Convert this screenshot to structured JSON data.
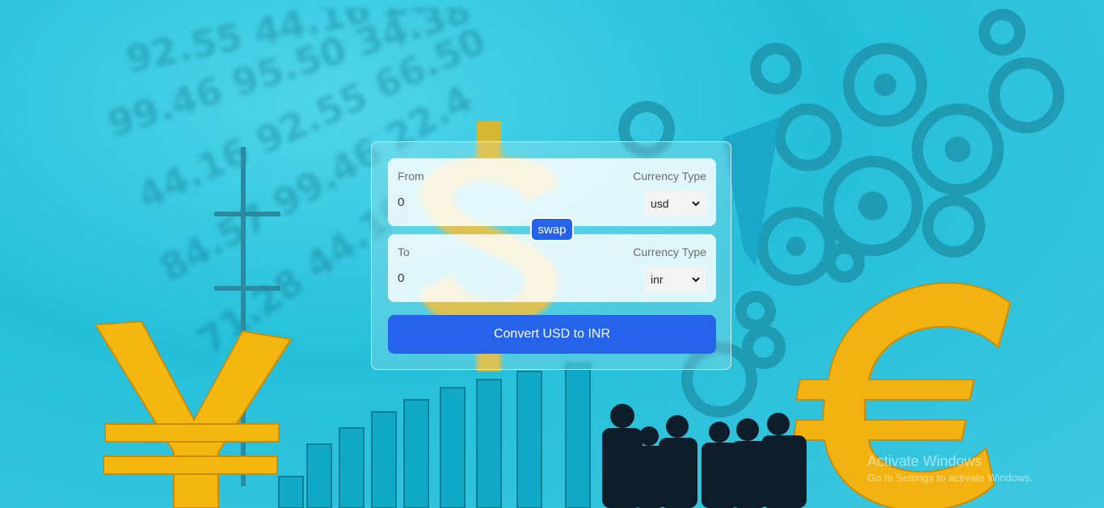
{
  "converter": {
    "from_label": "From",
    "from_currency_label": "Currency Type",
    "from_value": "0",
    "from_currency": "usd",
    "to_label": "To",
    "to_currency_label": "Currency Type",
    "to_value": "0",
    "to_currency": "inr",
    "swap_label": "swap",
    "convert_label": "Convert USD to INR"
  },
  "watermark": {
    "line1": "Activate Windows",
    "line2": "Go to Settings to activate Windows."
  },
  "colors": {
    "accent": "#2563eb",
    "background": "#25bfd9",
    "gold": "#f2b312"
  },
  "icons": {
    "dropdown": "chevron-down-icon"
  }
}
